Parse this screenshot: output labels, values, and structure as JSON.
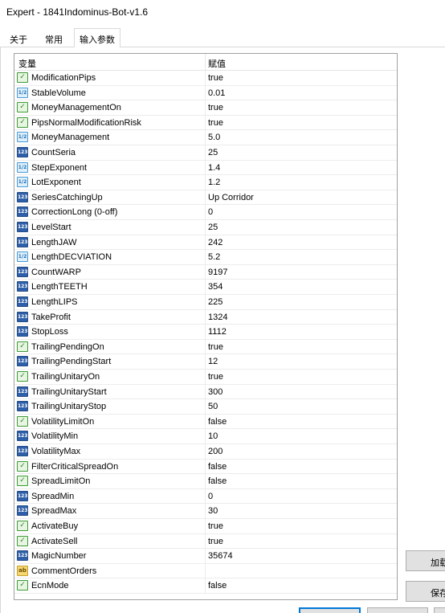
{
  "window": {
    "title": "Expert - 1841Indominus-Bot-v1.6"
  },
  "tabs": [
    {
      "label": "关于"
    },
    {
      "label": "常用"
    },
    {
      "label": "输入参数"
    }
  ],
  "grid": {
    "headers": {
      "variable": "变量",
      "value": "赋值"
    },
    "rows": [
      {
        "icon": "bool-icon",
        "name": "ModificationPips",
        "value": "true"
      },
      {
        "icon": "double-icon",
        "name": "StableVolume",
        "value": "0.01"
      },
      {
        "icon": "bool-icon",
        "name": "MoneyManagementOn",
        "value": "true"
      },
      {
        "icon": "bool-icon",
        "name": "PipsNormalModificationRisk",
        "value": "true"
      },
      {
        "icon": "double-icon",
        "name": "MoneyManagement",
        "value": "5.0"
      },
      {
        "icon": "int-icon",
        "name": "CountSeria",
        "value": "25"
      },
      {
        "icon": "double-icon",
        "name": "StepExponent",
        "value": "1.4"
      },
      {
        "icon": "double-icon",
        "name": "LotExponent",
        "value": "1.2"
      },
      {
        "icon": "int-icon",
        "name": "SeriesCatchingUp",
        "value": "Up Corridor"
      },
      {
        "icon": "int-icon",
        "name": "CorrectionLong (0-off)",
        "value": "0"
      },
      {
        "icon": "int-icon",
        "name": "LevelStart",
        "value": "25"
      },
      {
        "icon": "int-icon",
        "name": "LengthJAW",
        "value": "242"
      },
      {
        "icon": "double-icon",
        "name": "LengthDECVIATION",
        "value": "5.2"
      },
      {
        "icon": "int-icon",
        "name": "CountWARP",
        "value": "9197"
      },
      {
        "icon": "int-icon",
        "name": "LengthTEETH",
        "value": "354"
      },
      {
        "icon": "int-icon",
        "name": "LengthLIPS",
        "value": "225"
      },
      {
        "icon": "int-icon",
        "name": "TakeProfit",
        "value": "1324"
      },
      {
        "icon": "int-icon",
        "name": "StopLoss",
        "value": "1112"
      },
      {
        "icon": "bool-icon",
        "name": "TrailingPendingOn",
        "value": "true"
      },
      {
        "icon": "int-icon",
        "name": "TrailingPendingStart",
        "value": "12"
      },
      {
        "icon": "bool-icon",
        "name": "TrailingUnitaryOn",
        "value": "true"
      },
      {
        "icon": "int-icon",
        "name": "TrailingUnitaryStart",
        "value": "300"
      },
      {
        "icon": "int-icon",
        "name": "TrailingUnitaryStop",
        "value": "50"
      },
      {
        "icon": "bool-icon",
        "name": "VolatilityLimitOn",
        "value": "false"
      },
      {
        "icon": "int-icon",
        "name": "VolatilityMin",
        "value": "10"
      },
      {
        "icon": "int-icon",
        "name": "VolatilityMax",
        "value": "200"
      },
      {
        "icon": "bool-icon",
        "name": "FilterCriticalSpreadOn",
        "value": "false"
      },
      {
        "icon": "bool-icon",
        "name": "SpreadLimitOn",
        "value": "false"
      },
      {
        "icon": "int-icon",
        "name": "SpreadMin",
        "value": "0"
      },
      {
        "icon": "int-icon",
        "name": "SpreadMax",
        "value": "30"
      },
      {
        "icon": "bool-icon",
        "name": "ActivateBuy",
        "value": "true"
      },
      {
        "icon": "bool-icon",
        "name": "ActivateSell",
        "value": "true"
      },
      {
        "icon": "int-icon",
        "name": "MagicNumber",
        "value": "35674"
      },
      {
        "icon": "string-icon",
        "name": "CommentOrders",
        "value": ""
      },
      {
        "icon": "bool-icon",
        "name": "EcnMode",
        "value": "false"
      }
    ]
  },
  "side_buttons": {
    "load_label": "加载",
    "save_label": "保存"
  },
  "colors": {
    "bool": "#3d9b35",
    "int": "#2f5fa8",
    "double": "#4a9ad6",
    "string": "#f5d774",
    "focus": "#0078d7"
  }
}
